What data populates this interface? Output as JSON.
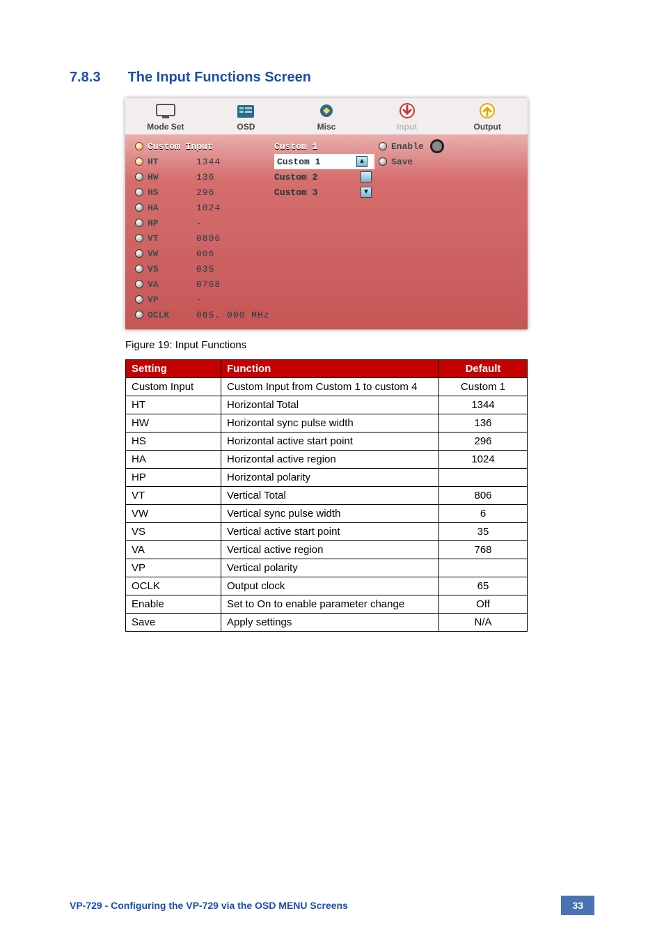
{
  "heading": {
    "number": "7.8.3",
    "title": "The Input Functions Screen"
  },
  "tabs": [
    {
      "id": "mode-set",
      "label": "Mode Set"
    },
    {
      "id": "osd",
      "label": "OSD"
    },
    {
      "id": "misc",
      "label": "Misc"
    },
    {
      "id": "input",
      "label": "Input",
      "active": true
    },
    {
      "id": "output",
      "label": "Output"
    }
  ],
  "osd": {
    "custom_input_label": "Custom Input",
    "params": [
      {
        "key": "HT",
        "value": "1344",
        "active": true
      },
      {
        "key": "HW",
        "value": "136"
      },
      {
        "key": "HS",
        "value": "296"
      },
      {
        "key": "HA",
        "value": "1024"
      },
      {
        "key": "HP",
        "value": "-"
      },
      {
        "key": "VT",
        "value": "0806"
      },
      {
        "key": "VW",
        "value": "006"
      },
      {
        "key": "VS",
        "value": "035"
      },
      {
        "key": "VA",
        "value": "0768"
      },
      {
        "key": "VP",
        "value": "-"
      },
      {
        "key": "OCLK",
        "value": "065. 000 MHz"
      }
    ],
    "custom_header": "Custom 1",
    "custom_options": [
      {
        "label": "Custom 1",
        "selected": true,
        "arrow": "up"
      },
      {
        "label": "Custom 2",
        "arrow": "none"
      },
      {
        "label": "Custom 3",
        "arrow": "down"
      }
    ],
    "enable_label": "Enable",
    "save_label": "Save"
  },
  "figure_caption": "Figure 19: Input Functions",
  "table": {
    "headers": {
      "setting": "Setting",
      "function": "Function",
      "default": "Default"
    },
    "rows": [
      {
        "setting": "Custom Input",
        "function": "Custom Input from Custom 1 to custom 4",
        "default": "Custom 1"
      },
      {
        "setting": "HT",
        "function": "Horizontal Total",
        "default": "1344"
      },
      {
        "setting": "HW",
        "function": "Horizontal sync pulse width",
        "default": "136"
      },
      {
        "setting": "HS",
        "function": "Horizontal active start point",
        "default": "296"
      },
      {
        "setting": "HA",
        "function": "Horizontal active region",
        "default": "1024"
      },
      {
        "setting": "HP",
        "function": "Horizontal polarity",
        "default": ""
      },
      {
        "setting": "VT",
        "function": "Vertical Total",
        "default": "806"
      },
      {
        "setting": "VW",
        "function": "Vertical sync pulse width",
        "default": "6"
      },
      {
        "setting": "VS",
        "function": "Vertical active start point",
        "default": "35"
      },
      {
        "setting": "VA",
        "function": "Vertical active region",
        "default": "768"
      },
      {
        "setting": "VP",
        "function": "Vertical polarity",
        "default": ""
      },
      {
        "setting": "OCLK",
        "function": "Output clock",
        "default": "65"
      },
      {
        "setting": "Enable",
        "function": "Set to On to enable parameter change",
        "default": "Off"
      },
      {
        "setting": "Save",
        "function": "Apply settings",
        "default": "N/A"
      }
    ]
  },
  "footer": {
    "left": "VP-729 - Configuring the VP-729 via the OSD MENU Screens",
    "page": "33"
  }
}
